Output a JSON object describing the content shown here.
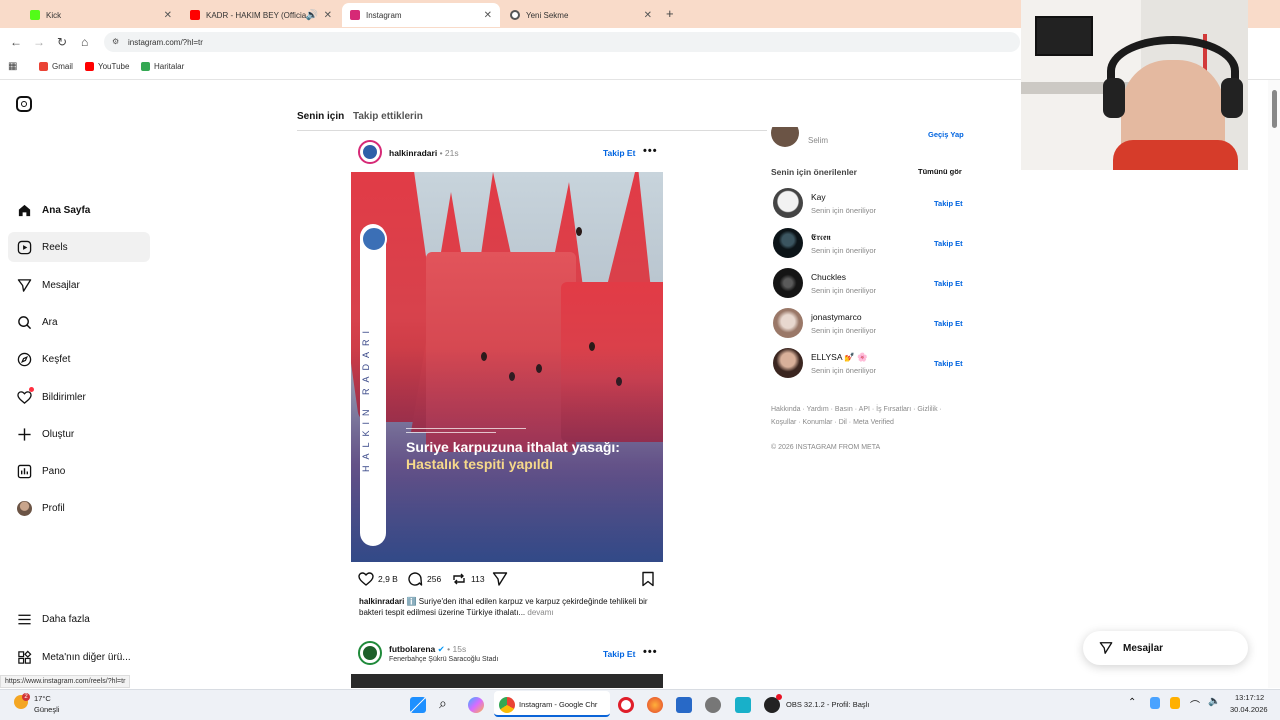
{
  "browser": {
    "tabs": [
      {
        "label": "Kick",
        "active": false,
        "color": "#53fc18"
      },
      {
        "label": "KADR - HAKIM BEY (Officia",
        "active": false,
        "color": "#ff0000"
      },
      {
        "label": "Instagram",
        "active": true,
        "color": "#d62976"
      },
      {
        "label": "Yeni Sekme",
        "active": false,
        "color": "#555555"
      }
    ],
    "url": "instagram.com/?hl=tr",
    "bookmarks": [
      "Gmail",
      "YouTube",
      "Haritalar"
    ]
  },
  "left_nav": {
    "items": [
      {
        "label": "Ana Sayfa",
        "icon": "home-icon"
      },
      {
        "label": "Reels",
        "icon": "reels-icon"
      },
      {
        "label": "Mesajlar",
        "icon": "messages-icon"
      },
      {
        "label": "Ara",
        "icon": "search-icon"
      },
      {
        "label": "Keşfet",
        "icon": "explore-icon"
      },
      {
        "label": "Bildirimler",
        "icon": "heart-icon"
      },
      {
        "label": "Oluştur",
        "icon": "plus-icon"
      },
      {
        "label": "Pano",
        "icon": "dashboard-icon"
      },
      {
        "label": "Profil",
        "icon": "avatar"
      }
    ],
    "bottom": [
      {
        "label": "Daha fazla",
        "icon": "menu-icon"
      },
      {
        "label": "Meta'nın diğer ürü...",
        "icon": "meta-apps-icon"
      }
    ]
  },
  "feed": {
    "tabs": [
      "Senin için",
      "Takip ettiklerin"
    ],
    "post1": {
      "username": "halkinradari",
      "time": "• 21s",
      "follow": "Takip Et",
      "image_side_text": "HALKIN RADARI",
      "headline_line1": "Suriye karpuzuna ithalat yasağı:",
      "headline_line2": "Hastalık tespiti yapıldı",
      "likes": "2,9 B",
      "comments": "256",
      "reposts": "113",
      "caption_user": "halkinradari",
      "caption_text": "ℹ️ Suriye'den ithal edilen karpuz ve karpuz çekirdeğinde tehlikeli bir bakteri tespit edilmesi üzerine Türkiye ithalatı...",
      "caption_more": "devamı"
    },
    "post2": {
      "username": "futbolarena",
      "time": "• 15s",
      "location": "Fenerbahçe Şükrü Saracoğlu Stadı",
      "follow": "Takip Et"
    }
  },
  "right": {
    "current_user": "Selim",
    "switch": "Geçiş Yap",
    "suggestions_title": "Senin için önerilenler",
    "see_all": "Tümünü gör",
    "suggestions": [
      {
        "name": "Kay",
        "sub": "Senin için öneriliyor",
        "follow": "Takip Et"
      },
      {
        "name": "𝕰𝖗𝖈𝖊𝖓",
        "sub": "Senin için öneriliyor",
        "follow": "Takip Et"
      },
      {
        "name": "Chuckles",
        "sub": "Senin için öneriliyor",
        "follow": "Takip Et"
      },
      {
        "name": "jonastymarco",
        "sub": "Senin için öneriliyor",
        "follow": "Takip Et"
      },
      {
        "name": "ELLYSA 💅 🌸",
        "sub": "Senin için öneriliyor",
        "follow": "Takip Et"
      }
    ],
    "footer_line1": "Hakkında · Yardım · Basın · API · İş Fırsatları · Gizlilik ·",
    "footer_line2": "Koşullar · Konumlar · Dil · Meta Verified",
    "copyright": "© 2026 INSTAGRAM FROM META"
  },
  "messages_pill": "Mesajlar",
  "status_url": "https://www.instagram.com/reels/?hl=tr",
  "taskbar": {
    "weather_temp": "17°C",
    "weather_label": "Güneşli",
    "chrome_label": "Instagram - Google Chr",
    "obs_label": "OBS 32.1.2 - Profil: Başlı",
    "time": "13:17:12",
    "date": "30.04.2026",
    "weather_badge": "2"
  }
}
